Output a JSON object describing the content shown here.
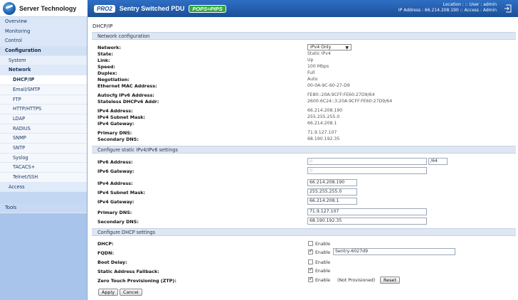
{
  "brand": {
    "name": "Server Technology"
  },
  "banner": {
    "pro_badge": "PRO2",
    "product": "Sentry Switched PDU",
    "pops_badge": "POPS=PIPS"
  },
  "session": {
    "line1": "Location :  ::  User : admin",
    "line2": "IP Address : 66.214.208.190  ::  Access : Admin"
  },
  "nav": {
    "overview": "Overview",
    "monitoring": "Monitoring",
    "control": "Control",
    "configuration": "Configuration",
    "system": "System",
    "network": "Network",
    "dhcp_ip": "DHCP/IP",
    "email_smtp": "Email/SMTP",
    "ftp": "FTP",
    "http_https": "HTTP/HTTPS",
    "ldap": "LDAP",
    "radius": "RADIUS",
    "snmp": "SNMP",
    "sntp": "SNTP",
    "syslog": "Syslog",
    "tacacs": "TACACS+",
    "telnet_ssh": "Telnet/SSH",
    "access": "Access",
    "tools": "Tools"
  },
  "page": {
    "title": "DHCP/IP"
  },
  "netconf": {
    "heading": "Network configuration",
    "network_label": "Network:",
    "network_value": "IPv4 Only",
    "state_label": "State:",
    "state_value": "Static IPv4",
    "link_label": "Link:",
    "link_value": "Up",
    "speed_label": "Speed:",
    "speed_value": "100 Mbps",
    "duplex_label": "Duplex:",
    "duplex_value": "Full",
    "negotiation_label": "Negotiation:",
    "negotiation_value": "Auto",
    "mac_label": "Ethernet MAC Address:",
    "mac_value": "00-0A-9C-60-27-D9",
    "autocfg_label": "Autocfg IPv6 Address:",
    "autocfg_value": "FE80::20A:9CFF:FE60:27D9/64",
    "stateless_label": "Stateless DHCPv6 Addr:",
    "stateless_value": "2600:6C24::3:20A:9CFF:FE60:27D9/64",
    "ipv4_addr_label": "IPv4 Address:",
    "ipv4_addr_value": "66.214.208.190",
    "ipv4_mask_label": "IPv4 Subnet Mask:",
    "ipv4_mask_value": "255.255.255.0",
    "ipv4_gw_label": "IPv4 Gateway:",
    "ipv4_gw_value": "66.214.208.1",
    "primary_dns_label": "Primary DNS:",
    "primary_dns_value": "71.9.127.107",
    "secondary_dns_label": "Secondary DNS:",
    "secondary_dns_value": "68.190.192.35"
  },
  "static": {
    "heading": "Configure static IPv4/IPv6 settings",
    "ipv6_addr_label": "IPv6 Address:",
    "ipv6_addr_value": "::",
    "ipv6_prefix_value": "/64",
    "ipv6_gw_label": "IPv6 Gateway:",
    "ipv6_gw_value": "::",
    "ipv4_addr_label": "IPv4 Address:",
    "ipv4_addr_value": "66.214.208.190",
    "ipv4_mask_label": "IPv4 Subnet Mask:",
    "ipv4_mask_value": "255.255.255.0",
    "ipv4_gw_label": "IPv4 Gateway:",
    "ipv4_gw_value": "66.214.208.1",
    "primary_dns_label": "Primary DNS:",
    "primary_dns_value": "71.9.127.107",
    "secondary_dns_label": "Secondary DNS:",
    "secondary_dns_value": "68.190.192.35"
  },
  "dhcp": {
    "heading": "Configure DHCP settings",
    "dhcp_label": "DHCP:",
    "fqdn_label": "FQDN:",
    "boot_delay_label": "Boot Delay:",
    "fallback_label": "Static Address Fallback:",
    "ztp_label": "Zero Touch Provisioning (ZTP):",
    "enable_text": "Enable",
    "fqdn_value": "Sentry-6027d9",
    "ztp_status": "(Not Provisioned)",
    "reset_label": "Reset"
  },
  "actions": {
    "apply": "Apply",
    "cancel": "Cancel"
  }
}
